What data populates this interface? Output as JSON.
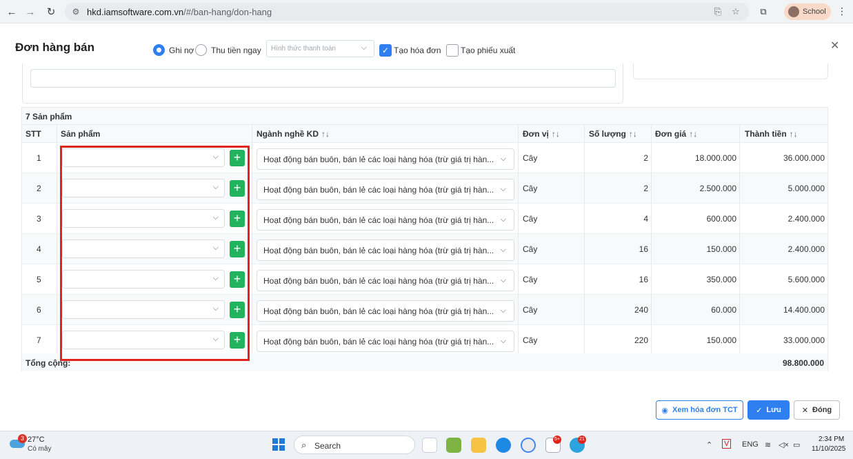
{
  "browser": {
    "url_host": "hkd.iamsoftware.com.vn",
    "url_path": "/#/ban-hang/don-hang",
    "profile_label": "School",
    "icons": {
      "back": "back-arrow-icon",
      "forward": "forward-arrow-icon",
      "reload": "reload-icon",
      "site_info": "site-settings-icon",
      "install": "install-app-icon",
      "bookmark": "star-icon",
      "extensions": "puzzle-icon",
      "menu": "more-vert-icon"
    }
  },
  "modal": {
    "title": "Đơn hàng bán",
    "radio_debt": "Ghi nợ",
    "radio_cash": "Thu tiền ngay",
    "payment_placeholder": "Hình thức thanh toán",
    "create_invoice": "Tạo hóa đơn",
    "create_export": "Tạo phiếu xuất",
    "caption": "7 Sản phẩm",
    "columns": {
      "stt": "STT",
      "product": "Sản phẩm",
      "business": "Ngành nghề KD",
      "unit": "Đơn vị",
      "qty": "Số lượng",
      "price": "Đơn giá",
      "amount": "Thành tiền",
      "sort_glyph": "↑↓"
    },
    "rows": [
      {
        "stt": "1",
        "business": "Hoạt động bán buôn, bán lẻ các loại hàng hóa (trừ giá trị hàn...",
        "unit": "Cây",
        "qty": "2",
        "price": "18.000.000",
        "amount": "36.000.000"
      },
      {
        "stt": "2",
        "business": "Hoạt động bán buôn, bán lẻ các loại hàng hóa (trừ giá trị hàn...",
        "unit": "Cây",
        "qty": "2",
        "price": "2.500.000",
        "amount": "5.000.000"
      },
      {
        "stt": "3",
        "business": "Hoạt động bán buôn, bán lẻ các loại hàng hóa (trừ giá trị hàn...",
        "unit": "Cây",
        "qty": "4",
        "price": "600.000",
        "amount": "2.400.000"
      },
      {
        "stt": "4",
        "business": "Hoạt động bán buôn, bán lẻ các loại hàng hóa (trừ giá trị hàn...",
        "unit": "Cây",
        "qty": "16",
        "price": "150.000",
        "amount": "2.400.000"
      },
      {
        "stt": "5",
        "business": "Hoạt động bán buôn, bán lẻ các loại hàng hóa (trừ giá trị hàn...",
        "unit": "Cây",
        "qty": "16",
        "price": "350.000",
        "amount": "5.600.000"
      },
      {
        "stt": "6",
        "business": "Hoạt động bán buôn, bán lẻ các loại hàng hóa (trừ giá trị hàn...",
        "unit": "Cây",
        "qty": "240",
        "price": "60.000",
        "amount": "14.400.000"
      },
      {
        "stt": "7",
        "business": "Hoạt động bán buôn, bán lẻ các loại hàng hóa (trừ giá trị hàn...",
        "unit": "Cây",
        "qty": "220",
        "price": "150.000",
        "amount": "33.000.000"
      }
    ],
    "total_label": "Tổng cộng:",
    "total_value": "98.800.000",
    "btn_view": "Xem hóa đơn TCT",
    "btn_save": "Lưu",
    "btn_close": "Đóng",
    "colors": {
      "primary": "#2f7ff1",
      "add": "#22b35e",
      "highlight": "#e0231c"
    }
  },
  "taskbar": {
    "weather_badge": "3",
    "temperature": "27°C",
    "condition": "Có mây",
    "search_label": "Search",
    "lang": "ENG",
    "time": "2:34 PM",
    "date": "11/10/2025",
    "badge_zalo": "5+",
    "badge_telegram": "21"
  }
}
